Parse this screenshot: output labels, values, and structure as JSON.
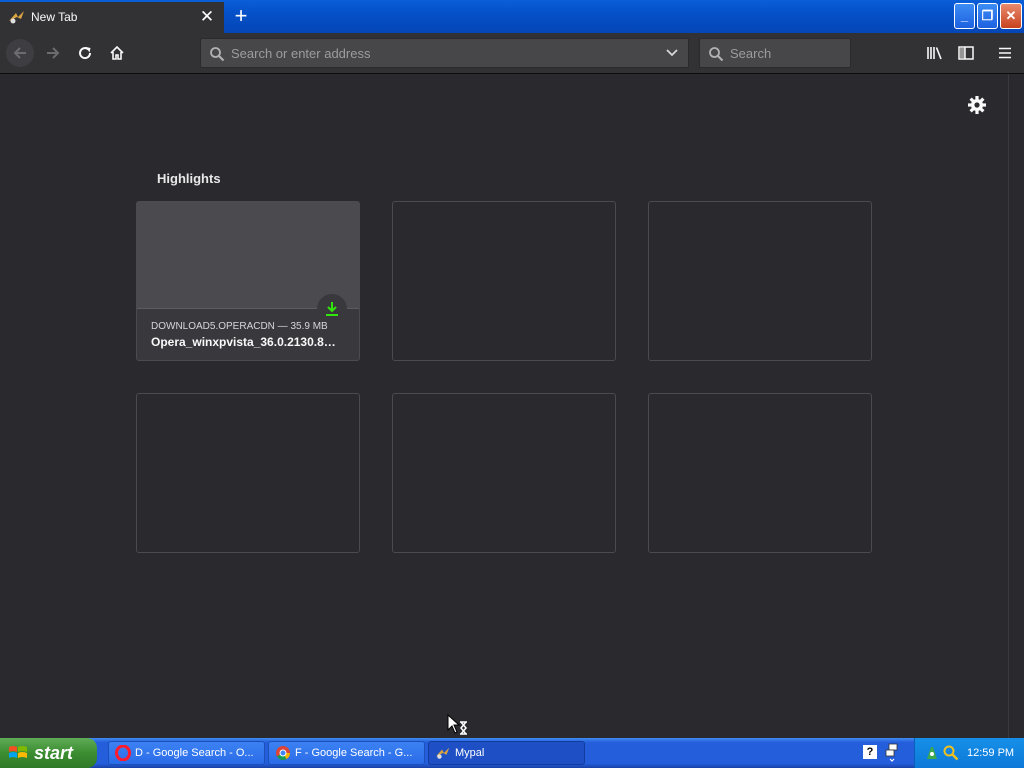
{
  "browser": {
    "tab": {
      "title": "New Tab",
      "close_glyph": "✕"
    },
    "new_tab_glyph": "+",
    "window_buttons": {
      "minimize": "_",
      "maximize": "❐",
      "close": "✕"
    },
    "urlbar": {
      "placeholder": "Search or enter address",
      "value": ""
    },
    "searchbar": {
      "placeholder": "Search",
      "value": ""
    },
    "icons": [
      "back-arrow-icon",
      "forward-arrow-icon",
      "reload-icon",
      "home-icon",
      "library-icon",
      "sidebar-icon",
      "hamburger-menu-icon",
      "settings-gear-icon"
    ]
  },
  "newtab": {
    "section_title": "Highlights",
    "cards": [
      {
        "source": "DOWNLOAD5.OPERACDN — 35.9 MB",
        "title": "Opera_winxpvista_36.0.2130.8…",
        "type": "download"
      },
      {
        "empty": true
      },
      {
        "empty": true
      },
      {
        "empty": true
      },
      {
        "empty": true
      },
      {
        "empty": true
      }
    ]
  },
  "taskbar": {
    "start_label": "start",
    "tasks": [
      {
        "label": "D - Google Search - O...",
        "icon": "opera-icon",
        "active": false
      },
      {
        "label": "F - Google Search - G...",
        "icon": "chrome-icon",
        "active": false
      },
      {
        "label": "Mypal",
        "icon": "mypal-icon",
        "active": true
      }
    ],
    "help_glyph": "?",
    "clock": "12:59 PM"
  },
  "colors": {
    "content_bg": "#2a2a2e",
    "toolbar_bg": "#323234",
    "xp_blue": "#245edb",
    "start_green": "#3c8d32",
    "download_green": "#30e60b"
  }
}
